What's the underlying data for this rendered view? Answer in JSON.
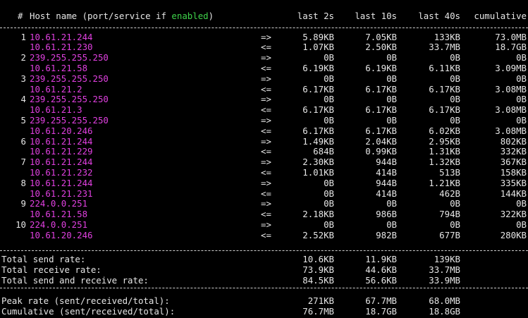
{
  "header": {
    "num": "#",
    "host_prefix": "Host name (port/service if ",
    "enabled": "enabled",
    "host_suffix": ")",
    "col_2s": "last 2s",
    "col_10s": "last 10s",
    "col_40s": "last 40s",
    "col_cum": "cumulative"
  },
  "colors": {
    "host": "#e040e0",
    "enabled": "#3ed34a",
    "text": "#e6e6e6",
    "background": "#000000"
  },
  "rows": [
    {
      "n": "1",
      "host": "10.61.21.244",
      "dir": "=>",
      "v2": "5.89KB",
      "v10": "7.05KB",
      "v40": "133KB",
      "cum": "73.0MB"
    },
    {
      "n": "",
      "host": "10.61.21.230",
      "dir": "<=",
      "v2": "1.07KB",
      "v10": "2.50KB",
      "v40": "33.7MB",
      "cum": "18.7GB"
    },
    {
      "n": "2",
      "host": "239.255.255.250",
      "dir": "=>",
      "v2": "0B",
      "v10": "0B",
      "v40": "0B",
      "cum": "0B"
    },
    {
      "n": "",
      "host": "10.61.21.58",
      "dir": "<=",
      "v2": "6.19KB",
      "v10": "6.19KB",
      "v40": "6.11KB",
      "cum": "3.09MB"
    },
    {
      "n": "3",
      "host": "239.255.255.250",
      "dir": "=>",
      "v2": "0B",
      "v10": "0B",
      "v40": "0B",
      "cum": "0B"
    },
    {
      "n": "",
      "host": "10.61.21.2",
      "dir": "<=",
      "v2": "6.17KB",
      "v10": "6.17KB",
      "v40": "6.17KB",
      "cum": "3.08MB"
    },
    {
      "n": "4",
      "host": "239.255.255.250",
      "dir": "=>",
      "v2": "0B",
      "v10": "0B",
      "v40": "0B",
      "cum": "0B"
    },
    {
      "n": "",
      "host": "10.61.21.3",
      "dir": "<=",
      "v2": "6.17KB",
      "v10": "6.17KB",
      "v40": "6.17KB",
      "cum": "3.08MB"
    },
    {
      "n": "5",
      "host": "239.255.255.250",
      "dir": "=>",
      "v2": "0B",
      "v10": "0B",
      "v40": "0B",
      "cum": "0B"
    },
    {
      "n": "",
      "host": "10.61.20.246",
      "dir": "<=",
      "v2": "6.17KB",
      "v10": "6.17KB",
      "v40": "6.02KB",
      "cum": "3.08MB"
    },
    {
      "n": "6",
      "host": "10.61.21.244",
      "dir": "=>",
      "v2": "1.49KB",
      "v10": "2.04KB",
      "v40": "2.95KB",
      "cum": "802KB"
    },
    {
      "n": "",
      "host": "10.61.21.229",
      "dir": "<=",
      "v2": "684B",
      "v10": "0.99KB",
      "v40": "1.31KB",
      "cum": "332KB"
    },
    {
      "n": "7",
      "host": "10.61.21.244",
      "dir": "=>",
      "v2": "2.30KB",
      "v10": "944B",
      "v40": "1.32KB",
      "cum": "367KB"
    },
    {
      "n": "",
      "host": "10.61.21.232",
      "dir": "<=",
      "v2": "1.01KB",
      "v10": "414B",
      "v40": "513B",
      "cum": "158KB"
    },
    {
      "n": "8",
      "host": "10.61.21.244",
      "dir": "=>",
      "v2": "0B",
      "v10": "944B",
      "v40": "1.21KB",
      "cum": "335KB"
    },
    {
      "n": "",
      "host": "10.61.21.231",
      "dir": "<=",
      "v2": "0B",
      "v10": "414B",
      "v40": "462B",
      "cum": "144KB"
    },
    {
      "n": "9",
      "host": "224.0.0.251",
      "dir": "=>",
      "v2": "0B",
      "v10": "0B",
      "v40": "0B",
      "cum": "0B"
    },
    {
      "n": "",
      "host": "10.61.21.58",
      "dir": "<=",
      "v2": "2.18KB",
      "v10": "986B",
      "v40": "794B",
      "cum": "322KB"
    },
    {
      "n": "10",
      "host": "224.0.0.251",
      "dir": "=>",
      "v2": "0B",
      "v10": "0B",
      "v40": "0B",
      "cum": "0B"
    },
    {
      "n": "",
      "host": "10.61.20.246",
      "dir": "<=",
      "v2": "2.52KB",
      "v10": "982B",
      "v40": "677B",
      "cum": "280KB"
    }
  ],
  "totals": [
    {
      "label": "Total send rate:",
      "v2": "10.6KB",
      "v10": "11.9KB",
      "v40": "139KB"
    },
    {
      "label": "Total receive rate:",
      "v2": "73.9KB",
      "v10": "44.6KB",
      "v40": "33.7MB"
    },
    {
      "label": "Total send and receive rate:",
      "v2": "84.5KB",
      "v10": "56.6KB",
      "v40": "33.9MB"
    }
  ],
  "peak": [
    {
      "label": "Peak rate (sent/received/total):",
      "v2": "271KB",
      "v10": "67.7MB",
      "v40": "68.0MB"
    },
    {
      "label": "Cumulative (sent/received/total):",
      "v2": "76.7MB",
      "v10": "18.7GB",
      "v40": "18.8GB"
    }
  ]
}
